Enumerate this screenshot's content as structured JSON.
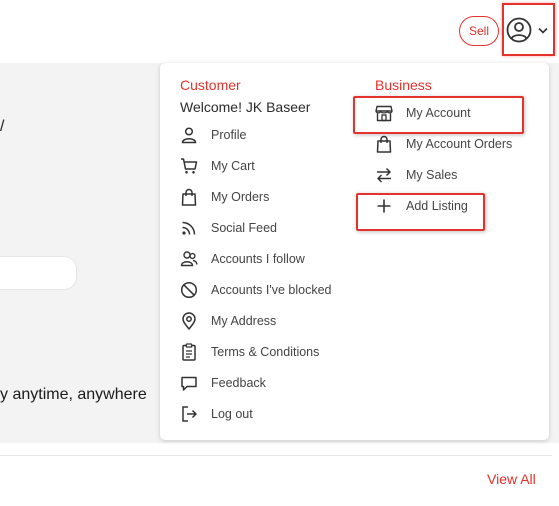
{
  "header": {
    "sell_label": "Sell",
    "account_icon": "user-circle-icon",
    "dropdown_icon": "chevron-down-icon"
  },
  "hero": {
    "partial_mark": "/",
    "tagline_partial": "y anytime, anywhere"
  },
  "section": {
    "view_all_label": "View All"
  },
  "menu": {
    "customer_heading": "Customer",
    "welcome_text": "Welcome! JK Baseer",
    "customer_items": [
      {
        "label": "Profile",
        "icon": "person-icon"
      },
      {
        "label": "My Cart",
        "icon": "cart-icon"
      },
      {
        "label": "My Orders",
        "icon": "shopping-bag-icon"
      },
      {
        "label": "Social Feed",
        "icon": "rss-icon"
      },
      {
        "label": "Accounts I follow",
        "icon": "people-icon"
      },
      {
        "label": "Accounts I've blocked",
        "icon": "block-icon"
      },
      {
        "label": "My Address",
        "icon": "location-pin-icon"
      },
      {
        "label": "Terms & Conditions",
        "icon": "clipboard-icon"
      },
      {
        "label": "Feedback",
        "icon": "chat-bubble-icon"
      },
      {
        "label": "Log out",
        "icon": "logout-icon"
      }
    ],
    "business_heading": "Business",
    "business_items": [
      {
        "label": "My Account",
        "icon": "store-icon"
      },
      {
        "label": "My Account Orders",
        "icon": "shopping-bag-icon"
      },
      {
        "label": "My Sales",
        "icon": "swap-arrows-icon"
      },
      {
        "label": "Add Listing",
        "icon": "plus-icon"
      }
    ]
  },
  "colors": {
    "accent": "#e5322d",
    "background": "#f3f3f3"
  }
}
